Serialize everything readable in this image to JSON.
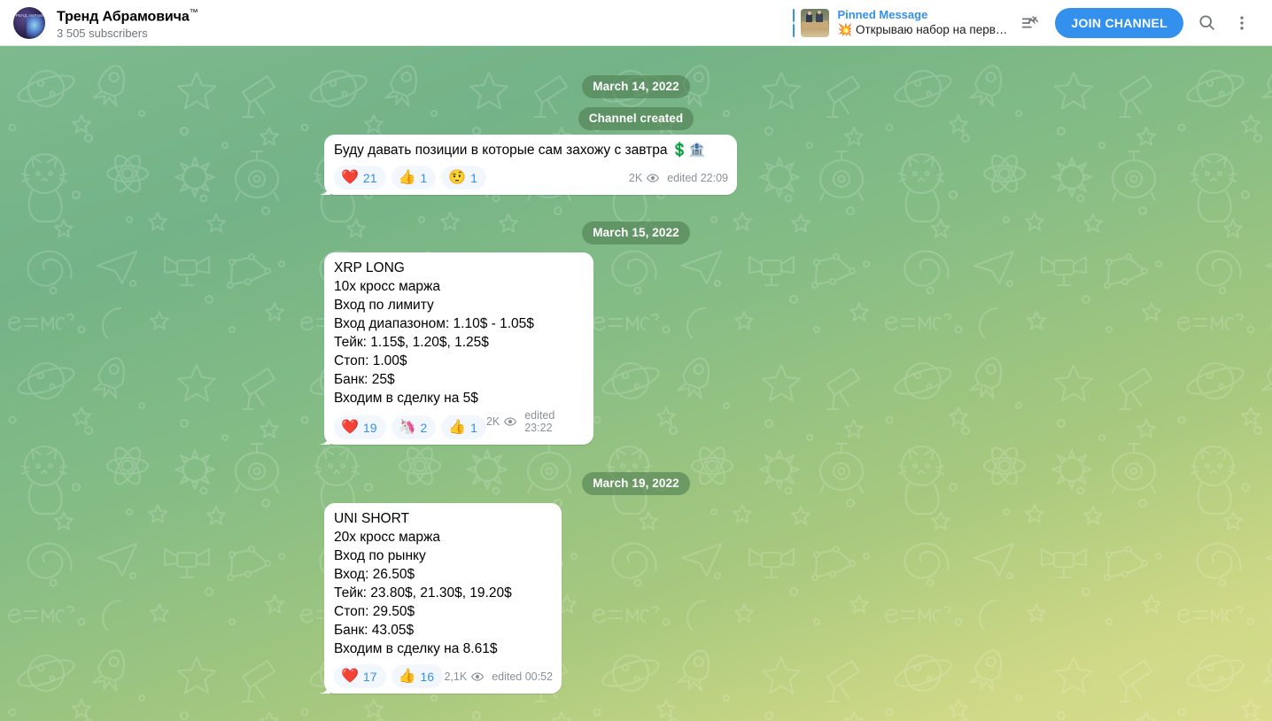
{
  "header": {
    "avatar_name": "channel-avatar",
    "avatar_caption": "ТРЕНД АБРАМОВИЧА",
    "title": "Тренд Абрамовича",
    "title_suffix": "™",
    "subscribers": "3 505 subscribers",
    "pinned": {
      "label": "Pinned Message",
      "preview": "💥 Открываю набор на перв…"
    },
    "pinned_list_icon": "pinned-messages-icon",
    "join_label": "JOIN CHANNEL",
    "search_icon": "search-icon",
    "menu_icon": "more-vertical-icon"
  },
  "messages": [
    {
      "type": "service",
      "text": "March 14, 2022"
    },
    {
      "type": "service",
      "text": "Channel created"
    },
    {
      "type": "message",
      "text": "Буду давать позиции в которые сам захожу с завтра 💲🏦",
      "reactions": [
        {
          "emoji": "❤️",
          "count": "21"
        },
        {
          "emoji": "👍",
          "count": "1"
        },
        {
          "emoji": "🤨",
          "count": "1"
        }
      ],
      "views": "2K",
      "edited": "edited 22:09"
    },
    {
      "type": "service",
      "text": "March 15, 2022"
    },
    {
      "type": "message",
      "text": "XRP LONG\n10x кросс маржа\nВход по лимиту\nВход диапазоном: 1.10$ - 1.05$\nТейк: 1.15$, 1.20$, 1.25$\nСтоп: 1.00$\nБанк: 25$\nВходим в сделку на 5$",
      "reactions": [
        {
          "emoji": "❤️",
          "count": "19"
        },
        {
          "emoji": "🦄",
          "count": "2"
        },
        {
          "emoji": "👍",
          "count": "1"
        }
      ],
      "views": "2K",
      "edited": "edited 23:22"
    },
    {
      "type": "service",
      "text": "March 19, 2022"
    },
    {
      "type": "message",
      "text": "UNI SHORT\n20x кросс маржа\nВход по рынку\nВход: 26.50$\nТейк: 23.80$, 21.30$, 19.20$\nСтоп: 29.50$\nБанк: 43.05$\nВходим в сделку на 8.61$",
      "reactions": [
        {
          "emoji": "❤️",
          "count": "17"
        },
        {
          "emoji": "👍",
          "count": "16"
        }
      ],
      "views": "2,1K",
      "edited": "edited 00:52"
    }
  ],
  "colors": {
    "accent": "#3390ec",
    "service_pill": "rgba(76,122,78,0.58)",
    "bubble": "#ffffff",
    "reaction_bg": "#f1f7fc",
    "meta_text": "#8a9096"
  }
}
